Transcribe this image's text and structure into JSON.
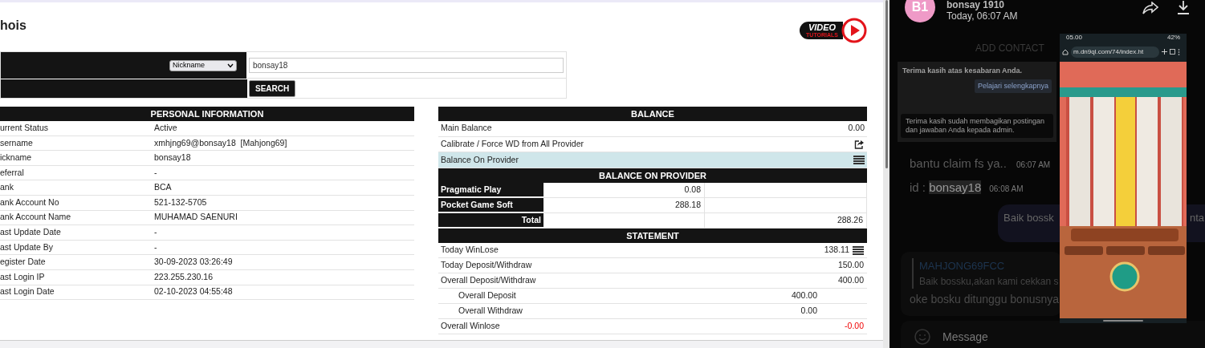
{
  "title": "hois",
  "video_logo": {
    "line1": "VIDEO",
    "line2": "TUTORIALS"
  },
  "search": {
    "type_select": "Nickname",
    "query": "bonsay18",
    "button": "SEARCH"
  },
  "personal_info": {
    "heading": "PERSONAL INFORMATION",
    "rows": [
      {
        "label": "urrent Status",
        "value": "Active"
      },
      {
        "label": "sername",
        "value": "xmhjng69@bonsay18  [Mahjong69]"
      },
      {
        "label": "ickname",
        "value": "bonsay18"
      },
      {
        "label": "eferral",
        "value": "-"
      },
      {
        "label": "ank",
        "value": "BCA"
      },
      {
        "label": "ank Account No",
        "value": "521-132-5705"
      },
      {
        "label": "ank Account Name",
        "value": "MUHAMAD SAENURI"
      },
      {
        "label": "ast Update Date",
        "value": "-"
      },
      {
        "label": "ast Update By",
        "value": "-"
      },
      {
        "label": "egister Date",
        "value": "30-09-2023 03:26:49"
      },
      {
        "label": "ast Login IP",
        "value": "223.255.230.16"
      },
      {
        "label": "ast Login Date",
        "value": "02-10-2023 04:55:48"
      }
    ]
  },
  "balance": {
    "heading": "BALANCE",
    "rows": [
      {
        "kind": "value",
        "label": "Main Balance",
        "value": "0.00",
        "highlighted": false
      },
      {
        "kind": "action",
        "label": "Calibrate / Force WD from All Provider",
        "highlighted": false
      },
      {
        "kind": "toggle",
        "label": "Balance On Provider",
        "highlighted": true
      }
    ]
  },
  "providers": {
    "heading": "BALANCE ON PROVIDER",
    "rows": [
      {
        "name": "Pragmatic Play",
        "balance": "0.08"
      },
      {
        "name": "Pocket Game Soft",
        "balance": "288.18"
      }
    ],
    "total_label": "Total",
    "total": "288.26"
  },
  "statement": {
    "heading": "STATEMENT",
    "rows": [
      {
        "kind": "main",
        "label": "Today WinLose",
        "value": "138.11",
        "negative": false,
        "details": true
      },
      {
        "kind": "main",
        "label": "Today Deposit/Withdraw",
        "value": "150.00",
        "negative": false,
        "details": false
      },
      {
        "kind": "main",
        "label": "Overall Deposit/Withdraw",
        "value": "400.00",
        "negative": false,
        "details": false
      },
      {
        "kind": "sub",
        "label": "Overall Deposit",
        "value": "400.00",
        "negative": false,
        "details": false
      },
      {
        "kind": "sub",
        "label": "Overall Withdraw",
        "value": "0.00",
        "negative": false,
        "details": false
      },
      {
        "kind": "main",
        "label": "Overall Winlose",
        "value": "-0.00",
        "negative": true,
        "details": false
      }
    ]
  },
  "chat": {
    "contact": {
      "initials": "B1",
      "name": "bonsay 1910",
      "last_seen": "Today, 06:07 AM"
    },
    "add_contact": "ADD CONTACT",
    "dialog": {
      "title": "Terima kasih atas kesabaran Anda.",
      "link": "Pelajari selengkapnya",
      "toast": "Terima kasih sudah membagikan postingan dan jawaban Anda kepada admin."
    },
    "messages": [
      {
        "kind": "text",
        "text": "bantu claim fs ya..",
        "time": "06:07 AM"
      },
      {
        "kind": "id",
        "prefix": "id : ",
        "highlight": "bonsay18",
        "time": "06:08 AM"
      },
      {
        "kind": "outgoing",
        "parts": [
          "Baik bossk",
          "nta"
        ]
      },
      {
        "kind": "reply",
        "quote_author": "MAHJONG69FCC",
        "quote_text": "Baik bossku,akan kami cekkan s",
        "text": "oke bosku ditunggu bonusnya"
      }
    ],
    "composer_placeholder": "Message"
  },
  "phone_screenshot": {
    "time": "05.00",
    "battery": "42%",
    "url": "m.dn9ql.com/74/index.ht"
  }
}
